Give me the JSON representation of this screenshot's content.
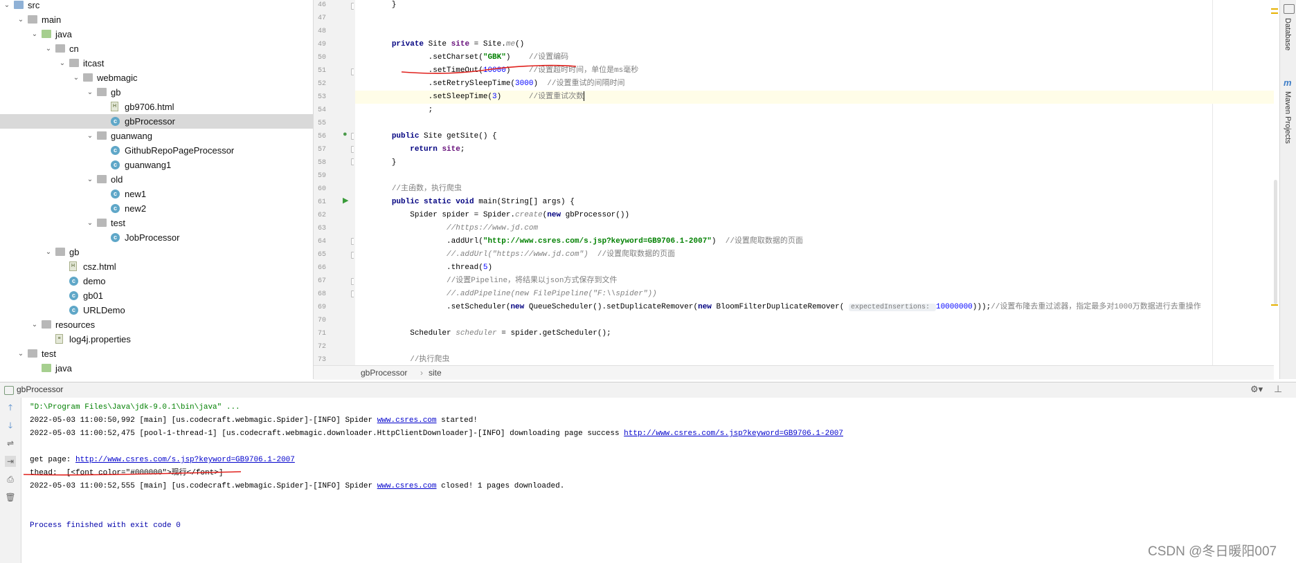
{
  "tree": {
    "items": [
      {
        "label": "src",
        "type": "folder-src",
        "open": true
      },
      {
        "label": "main",
        "type": "folder",
        "open": true
      },
      {
        "label": "java",
        "type": "folder-java",
        "open": true
      },
      {
        "label": "cn",
        "type": "folder",
        "open": true
      },
      {
        "label": "itcast",
        "type": "folder",
        "open": true
      },
      {
        "label": "webmagic",
        "type": "folder",
        "open": true
      },
      {
        "label": "gb",
        "type": "folder",
        "open": true
      },
      {
        "label": "gb9706.html",
        "type": "html"
      },
      {
        "label": "gbProcessor",
        "type": "class",
        "selected": true
      },
      {
        "label": "guanwang",
        "type": "folder",
        "open": true
      },
      {
        "label": "GithubRepoPageProcessor",
        "type": "class"
      },
      {
        "label": "guanwang1",
        "type": "class"
      },
      {
        "label": "old",
        "type": "folder",
        "open": true
      },
      {
        "label": "new1",
        "type": "class"
      },
      {
        "label": "new2",
        "type": "class"
      },
      {
        "label": "test",
        "type": "folder",
        "open": true
      },
      {
        "label": "JobProcessor",
        "type": "class"
      },
      {
        "label": "gb",
        "type": "folder",
        "open": true
      },
      {
        "label": "csz.html",
        "type": "html"
      },
      {
        "label": "demo",
        "type": "class"
      },
      {
        "label": "gb01",
        "type": "class"
      },
      {
        "label": "URLDemo",
        "type": "class"
      },
      {
        "label": "resources",
        "type": "folder-res",
        "open": true
      },
      {
        "label": "log4j.properties",
        "type": "props"
      },
      {
        "label": "test",
        "type": "folder",
        "open": true
      },
      {
        "label": "java",
        "type": "folder-java"
      }
    ]
  },
  "editor": {
    "line_numbers": [
      "46",
      "47",
      "48",
      "49",
      "50",
      "51",
      "52",
      "53",
      "54",
      "55",
      "56",
      "57",
      "58",
      "59",
      "60",
      "61",
      "62",
      "63",
      "64",
      "65",
      "66",
      "67",
      "68",
      "69",
      "70",
      "71",
      "72",
      "73"
    ],
    "lines": [
      [
        {
          "t": "        }",
          "c": ""
        }
      ],
      [
        {
          "t": "",
          "c": ""
        }
      ],
      [
        {
          "t": "",
          "c": ""
        }
      ],
      [
        {
          "t": "        ",
          "c": ""
        },
        {
          "t": "private ",
          "c": "kw"
        },
        {
          "t": "Site ",
          "c": ""
        },
        {
          "t": "site",
          "c": "fld"
        },
        {
          "t": " = Site.",
          "c": ""
        },
        {
          "t": "me",
          "c": "cmt"
        },
        {
          "t": "()",
          "c": ""
        }
      ],
      [
        {
          "t": "                .setCharset(",
          "c": ""
        },
        {
          "t": "\"GBK\"",
          "c": "str"
        },
        {
          "t": ")    ",
          "c": ""
        },
        {
          "t": "//设置编码",
          "c": "cmtcn"
        }
      ],
      [
        {
          "t": "                .setTimeOut(",
          "c": ""
        },
        {
          "t": "10000",
          "c": "num"
        },
        {
          "t": ")    ",
          "c": ""
        },
        {
          "t": "//设置超时时间，单位是ms毫秒",
          "c": "cmtcn"
        }
      ],
      [
        {
          "t": "                .setRetrySleepTime(",
          "c": ""
        },
        {
          "t": "3000",
          "c": "num"
        },
        {
          "t": ")  ",
          "c": ""
        },
        {
          "t": "//设置重试的间隔时间",
          "c": "cmtcn"
        }
      ],
      [
        {
          "t": "                .setSleepTime(",
          "c": ""
        },
        {
          "t": "3",
          "c": "num"
        },
        {
          "t": ")      ",
          "c": ""
        },
        {
          "t": "//设置重试次数",
          "c": "cmtcn"
        }
      ],
      [
        {
          "t": "                ;",
          "c": ""
        }
      ],
      [
        {
          "t": "",
          "c": ""
        }
      ],
      [
        {
          "t": "        ",
          "c": ""
        },
        {
          "t": "public ",
          "c": "kw"
        },
        {
          "t": "Site getSite() {",
          "c": ""
        }
      ],
      [
        {
          "t": "            ",
          "c": ""
        },
        {
          "t": "return ",
          "c": "kw"
        },
        {
          "t": "site",
          "c": "fld"
        },
        {
          "t": ";",
          "c": ""
        }
      ],
      [
        {
          "t": "        }",
          "c": ""
        }
      ],
      [
        {
          "t": "",
          "c": ""
        }
      ],
      [
        {
          "t": "        ",
          "c": ""
        },
        {
          "t": "//主函数，执行爬虫",
          "c": "cmtcn"
        }
      ],
      [
        {
          "t": "        ",
          "c": ""
        },
        {
          "t": "public static void ",
          "c": "kw"
        },
        {
          "t": "main(String[] args) {",
          "c": ""
        }
      ],
      [
        {
          "t": "            Spider spider = Spider.",
          "c": ""
        },
        {
          "t": "create",
          "c": "cmt"
        },
        {
          "t": "(",
          "c": ""
        },
        {
          "t": "new ",
          "c": "kw"
        },
        {
          "t": "gbProcessor())",
          "c": ""
        }
      ],
      [
        {
          "t": "                    ",
          "c": ""
        },
        {
          "t": "//https://www.jd.com",
          "c": "cmt"
        }
      ],
      [
        {
          "t": "                    .addUrl(",
          "c": ""
        },
        {
          "t": "\"http://www.csres.com/s.jsp?keyword=GB9706.1-2007\"",
          "c": "str"
        },
        {
          "t": ")  ",
          "c": ""
        },
        {
          "t": "//设置爬取数据的页面",
          "c": "cmtcn"
        }
      ],
      [
        {
          "t": "                    ",
          "c": ""
        },
        {
          "t": "//.addUrl(\"https://www.jd.com\")  ",
          "c": "cmt"
        },
        {
          "t": "//设置爬取数据的页面",
          "c": "cmtcn"
        }
      ],
      [
        {
          "t": "                    .thread(",
          "c": ""
        },
        {
          "t": "5",
          "c": "num"
        },
        {
          "t": ")",
          "c": ""
        }
      ],
      [
        {
          "t": "                    ",
          "c": ""
        },
        {
          "t": "//设置Pipeline，将结果以json方式保存到文件",
          "c": "cmtcn"
        }
      ],
      [
        {
          "t": "                    ",
          "c": ""
        },
        {
          "t": "//.addPipeline(new FilePipeline(\"F:\\\\spider\"))",
          "c": "cmt"
        }
      ],
      [
        {
          "t": "                    .setScheduler(",
          "c": ""
        },
        {
          "t": "new ",
          "c": "kw"
        },
        {
          "t": "QueueScheduler().setDuplicateRemover(",
          "c": ""
        },
        {
          "t": "new ",
          "c": "kw"
        },
        {
          "t": "BloomFilterDuplicateRemover( ",
          "c": ""
        },
        {
          "t": "expectedInsertions: ",
          "c": "hint"
        },
        {
          "t": "10000000",
          "c": "num"
        },
        {
          "t": ")));",
          "c": ""
        },
        {
          "t": "//设置布隆去重过滤器，指定最多对1000万数据进行去重操作",
          "c": "cmtcn"
        }
      ],
      [
        {
          "t": "",
          "c": ""
        }
      ],
      [
        {
          "t": "            Scheduler ",
          "c": ""
        },
        {
          "t": "scheduler",
          "c": "cmt"
        },
        {
          "t": " = spider.getScheduler();",
          "c": ""
        }
      ],
      [
        {
          "t": "",
          "c": ""
        }
      ],
      [
        {
          "t": "            ",
          "c": ""
        },
        {
          "t": "//执行爬虫",
          "c": "cmtcn"
        }
      ]
    ]
  },
  "breadcrumbs": {
    "first": "gbProcessor",
    "sep": "›",
    "second": "site"
  },
  "right_tools": {
    "database": "Database",
    "maven": "Maven Projects"
  },
  "run": {
    "title": "gbProcessor",
    "console": [
      {
        "segs": [
          {
            "t": "\"D:\\Program Files\\Java\\jdk-9.0.1\\bin\\java\" ...",
            "c": "cpath"
          }
        ]
      },
      {
        "segs": [
          {
            "t": "2022-05-03 11:00:50,992 [main] [us.codecraft.webmagic.Spider]-[INFO] Spider ",
            "c": ""
          },
          {
            "t": "www.csres.com",
            "c": "clink"
          },
          {
            "t": " started!",
            "c": ""
          }
        ]
      },
      {
        "segs": [
          {
            "t": "2022-05-03 11:00:52,475 [pool-1-thread-1] [us.codecraft.webmagic.downloader.HttpClientDownloader]-[INFO] downloading page success ",
            "c": ""
          },
          {
            "t": "http://www.csres.com/s.jsp?keyword=GB9706.1-2007",
            "c": "clink"
          }
        ]
      },
      {
        "segs": [
          {
            "t": "",
            "c": ""
          }
        ]
      },
      {
        "segs": [
          {
            "t": "get page: ",
            "c": ""
          },
          {
            "t": "http://www.csres.com/s.jsp?keyword=GB9706.1-2007",
            "c": "clink"
          }
        ]
      },
      {
        "segs": [
          {
            "t": "thead:  [<font color=\"#000000\">现行</font>]",
            "c": ""
          }
        ]
      },
      {
        "segs": [
          {
            "t": "2022-05-03 11:00:52,555 [main] [us.codecraft.webmagic.Spider]-[INFO] Spider ",
            "c": ""
          },
          {
            "t": "www.csres.com",
            "c": "clink"
          },
          {
            "t": " closed! 1 pages downloaded.",
            "c": ""
          }
        ]
      },
      {
        "segs": [
          {
            "t": "",
            "c": ""
          }
        ]
      },
      {
        "segs": [
          {
            "t": "",
            "c": ""
          }
        ]
      },
      {
        "segs": [
          {
            "t": "Process finished with exit code 0",
            "c": "cfin"
          }
        ]
      }
    ]
  },
  "watermark": "CSDN @冬日暖阳007",
  "colors": {
    "accent": "#3f7ec7",
    "annotation": "#e0201c",
    "selection": "#d9d9d9"
  }
}
